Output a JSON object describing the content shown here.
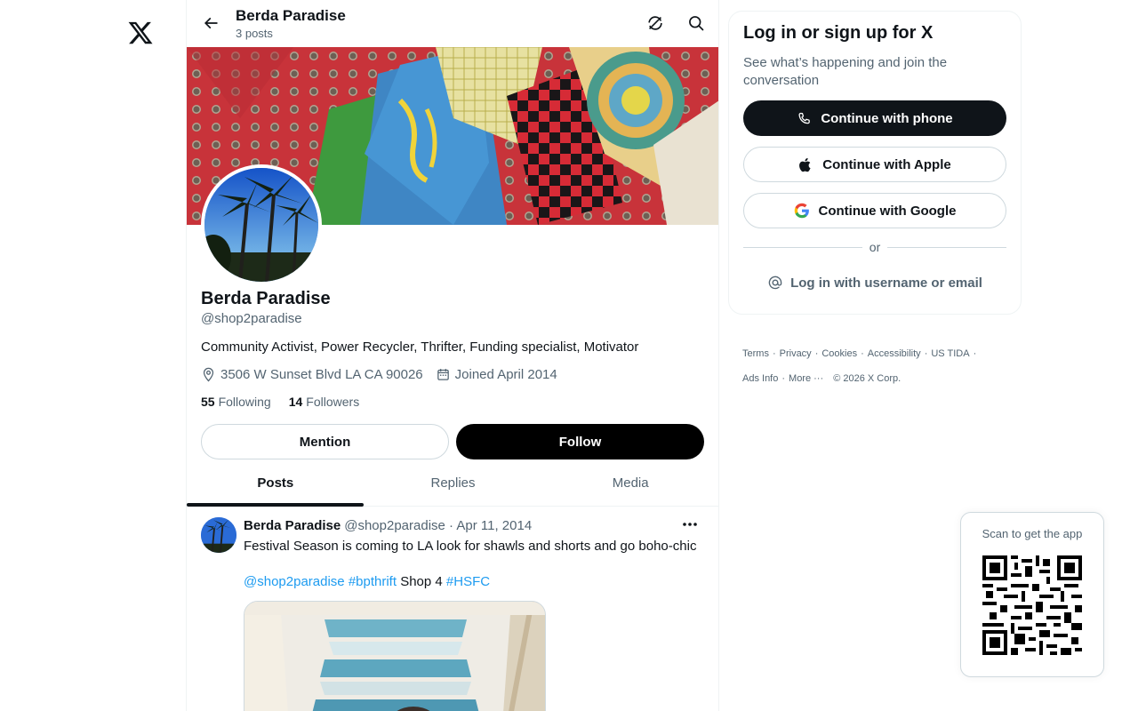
{
  "app": {
    "logo": "x-logo"
  },
  "header": {
    "title": "Berda Paradise",
    "subtitle": "3 posts",
    "icons": [
      "back-arrow-icon",
      "grok-icon",
      "search-icon"
    ]
  },
  "profile": {
    "name": "Berda Paradise",
    "handle": "@shop2paradise",
    "bio": "Community Activist, Power Recycler, Thrifter, Funding specialist, Motivator",
    "location": "3506 W Sunset Blvd LA CA 90026",
    "joined": "Joined April 2014",
    "following_count": "55",
    "following_label": "Following",
    "followers_count": "14",
    "followers_label": "Followers",
    "mention_label": "Mention",
    "follow_label": "Follow"
  },
  "tabs": [
    {
      "label": "Posts",
      "active": true
    },
    {
      "label": "Replies",
      "active": false
    },
    {
      "label": "Media",
      "active": false
    }
  ],
  "post": {
    "author": "Berda Paradise",
    "meta": "@shop2paradise · Apr 11, 2014",
    "text": "Festival Season is coming to LA look for shawls and shorts and go boho-chic",
    "mention": "@shop2paradise",
    "hashtag1": "#bpthrift",
    "plain": "Shop 4",
    "hashtag2": "#HSFC"
  },
  "login": {
    "title": "Log in or sign up for X",
    "subtitle": "See what’s happening and join the conversation",
    "phone_label": "Continue with phone",
    "apple_label": "Continue with Apple",
    "google_label": "Continue with Google",
    "or_label": "or",
    "username_label": "Log in with username or email"
  },
  "footer": {
    "links": [
      "Terms",
      "Privacy",
      "Cookies",
      "Accessibility",
      "US TIDA",
      "Ads Info",
      "More ···"
    ],
    "copyright": "© 2026 X Corp."
  },
  "qr": {
    "label": "Scan to get the app"
  },
  "colors": {
    "link": "#1d9bf0",
    "text_primary": "#0f1419",
    "text_secondary": "#536471",
    "border": "#cfd9de"
  }
}
